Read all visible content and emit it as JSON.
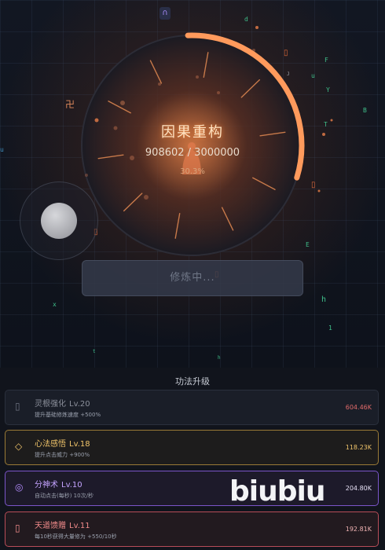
{
  "game": {
    "title": "因果重构",
    "progress_text": "908602 / 3000000",
    "progress_percent_text": "30.3%",
    "progress_fraction": 0.303,
    "action_button_label": "修炼中...",
    "top_icon": "∩",
    "float_symbols": [
      "卍",
      "▯",
      "▯",
      "▯",
      "▯"
    ],
    "float_letters": [
      "d",
      "F",
      "u",
      "Y",
      "B",
      "T",
      "E",
      "x",
      "h",
      "1",
      "t",
      "h",
      "u",
      "J"
    ]
  },
  "colors": {
    "accent": "#ff9a5c",
    "ring": "#2a2a33",
    "tier_default": "#2a303c",
    "tier_gold": "#c79a3c",
    "tier_purple": "#8b5cf6",
    "tier_red": "#e26a6a"
  },
  "panel": {
    "title": "功法升级",
    "upgrades": [
      {
        "icon": "▯",
        "icon_name": "root-icon",
        "name": "灵根强化",
        "level": "Lv.20",
        "desc": "提升基础修炼速度 +500%",
        "cost": "604.46K",
        "name_color": "#8c909b",
        "icon_color": "#6d7280",
        "cost_color": "#e06a6a",
        "border": "#2a303c",
        "bg": "#1a1e28"
      },
      {
        "icon": "◇",
        "icon_name": "diamond-icon",
        "name": "心法感悟",
        "level": "Lv.18",
        "desc": "提升点击威力 +900%",
        "cost": "118.23K",
        "name_color": "#f0c46a",
        "icon_color": "#f0c46a",
        "cost_color": "#f0c46a",
        "border": "#9a7a36",
        "bg": "#1d1c1c"
      },
      {
        "icon": "◎",
        "icon_name": "target-icon",
        "name": "分神术",
        "level": "Lv.10",
        "desc": "自动点击(每秒) 10次/秒",
        "cost": "204.80K",
        "name_color": "#c4a3ff",
        "icon_color": "#b48cff",
        "cost_color": "#e6e0f5",
        "border": "#7b55c9",
        "bg": "#1d1a2a"
      },
      {
        "icon": "▯",
        "icon_name": "gift-icon",
        "name": "天道馈赠",
        "level": "Lv.11",
        "desc": "每10秒获得大量修为 +550/10秒",
        "cost": "192.81K",
        "name_color": "#f08a8a",
        "icon_color": "#f08a8a",
        "cost_color": "#f0b3b3",
        "border": "#b84d58",
        "bg": "#221a1f"
      }
    ]
  },
  "watermark": "biubiu"
}
